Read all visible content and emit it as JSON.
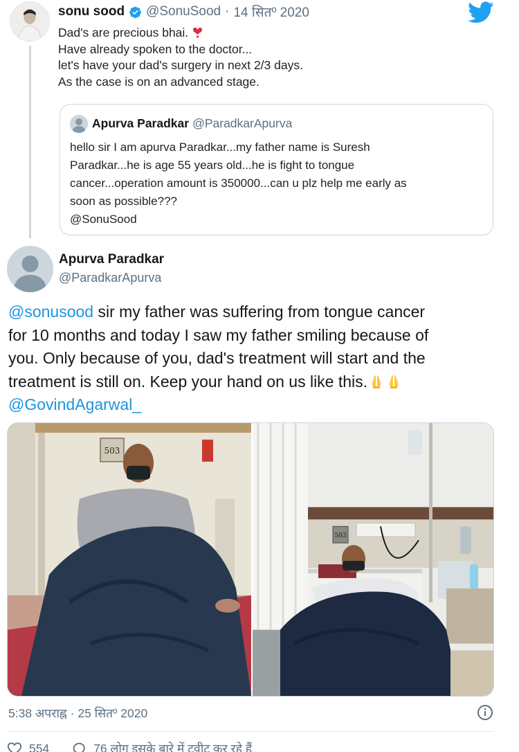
{
  "parent_tweet": {
    "author_name": "sonu sood",
    "handle": "@SonuSood",
    "separator": "·",
    "date": "14 सितº 2020",
    "lines": [
      "Dad's are precious bhai.",
      "Have already spoken to the doctor...",
      "let's have your dad's surgery in next 2/3 days.",
      "As the case is on an advanced stage."
    ],
    "quoted": {
      "author_name": "Apurva Paradkar",
      "handle": "@ParadkarApurva",
      "lines": [
        "hello sir I am apurva Paradkar...my father name is Suresh",
        "Paradkar...he is age 55 years old...he is fight to tongue",
        "cancer...operation amount is 350000...can u plz help me early as",
        "soon as possible???",
        "@SonuSood"
      ]
    }
  },
  "main_tweet": {
    "author_name": "Apurva Paradkar",
    "handle": "@ParadkarApurva",
    "mention_start": "@sonusood",
    "line1_rest": " sir my father was suffering from tongue cancer",
    "line2": "for 10 months and today I saw my father smiling because of",
    "line3": "you.  Only because of you, dad's treatment will start and the",
    "line4": "treatment is still on.  Keep your hand on us like this.",
    "mention_end": "@GovindAgarwal_",
    "photos": {
      "left_room_number": "503",
      "right_room_number": "503"
    },
    "timestamp": "5:38 अपराह्न · 25 सितº 2020",
    "likes": "554",
    "people_talking": "76 लोग इसके बारे में ट्वीट कर रहे हैं"
  },
  "colors": {
    "link": "#1b95e0",
    "twitter_blue": "#1da1f2",
    "secondary_text": "#5b7083",
    "border": "#ccd6dd"
  },
  "icons": [
    "verified-badge-icon",
    "heart-icon",
    "twitter-bird-icon",
    "folded-hands-icon",
    "info-icon",
    "like-icon",
    "reply-icon"
  ]
}
